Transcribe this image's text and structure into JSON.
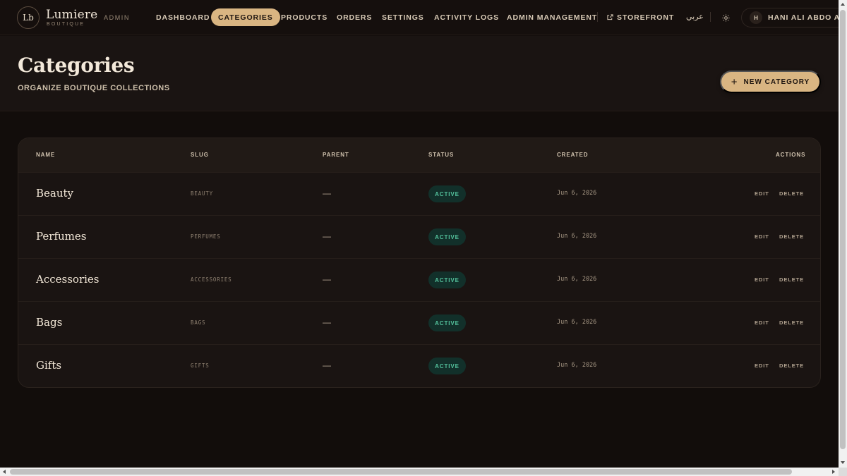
{
  "brand": {
    "monogram": "Lb",
    "name": "Lumiere",
    "sub": "BOUTIQUE",
    "area": "ADMIN"
  },
  "nav": {
    "items": [
      {
        "label": "DASHBOARD"
      },
      {
        "label": "CATEGORIES",
        "active": true
      },
      {
        "label": "PRODUCTS"
      },
      {
        "label": "ORDERS"
      },
      {
        "label": "SETTINGS"
      },
      {
        "label": "ACTIVITY LOGS"
      },
      {
        "label": "ADMIN MANAGEMENT"
      }
    ],
    "storefront": "STOREFRONT",
    "language": "عربي",
    "theme_icon": "sun-icon",
    "user": {
      "initial": "H",
      "name": "HANI ALI ABDO ALSI"
    }
  },
  "page": {
    "title": "Categories",
    "subtitle": "ORGANIZE BOUTIQUE COLLECTIONS",
    "new_button": "NEW CATEGORY",
    "new_button_icon": "+"
  },
  "table": {
    "columns": {
      "name": "NAME",
      "slug": "SLUG",
      "parent": "PARENT",
      "status": "STATUS",
      "created": "CREATED",
      "actions": "ACTIONS"
    },
    "rows": [
      {
        "name": "Beauty",
        "slug": "BEAUTY",
        "parent": "—",
        "status": "ACTIVE",
        "created": "Jun 6, 2026",
        "edit": "EDIT",
        "delete": "DELETE"
      },
      {
        "name": "Perfumes",
        "slug": "PERFUMES",
        "parent": "—",
        "status": "ACTIVE",
        "created": "Jun 6, 2026",
        "edit": "EDIT",
        "delete": "DELETE"
      },
      {
        "name": "Accessories",
        "slug": "ACCESSORIES",
        "parent": "—",
        "status": "ACTIVE",
        "created": "Jun 6, 2026",
        "edit": "EDIT",
        "delete": "DELETE"
      },
      {
        "name": "Bags",
        "slug": "BAGS",
        "parent": "—",
        "status": "ACTIVE",
        "created": "Jun 6, 2026",
        "edit": "EDIT",
        "delete": "DELETE"
      },
      {
        "name": "Gifts",
        "slug": "GIFTS",
        "parent": "—",
        "status": "ACTIVE",
        "created": "Jun 6, 2026",
        "edit": "EDIT",
        "delete": "DELETE"
      }
    ]
  },
  "colors": {
    "accent": "#d9b582",
    "background": "#120d0b",
    "status_active": "#54c39d"
  }
}
